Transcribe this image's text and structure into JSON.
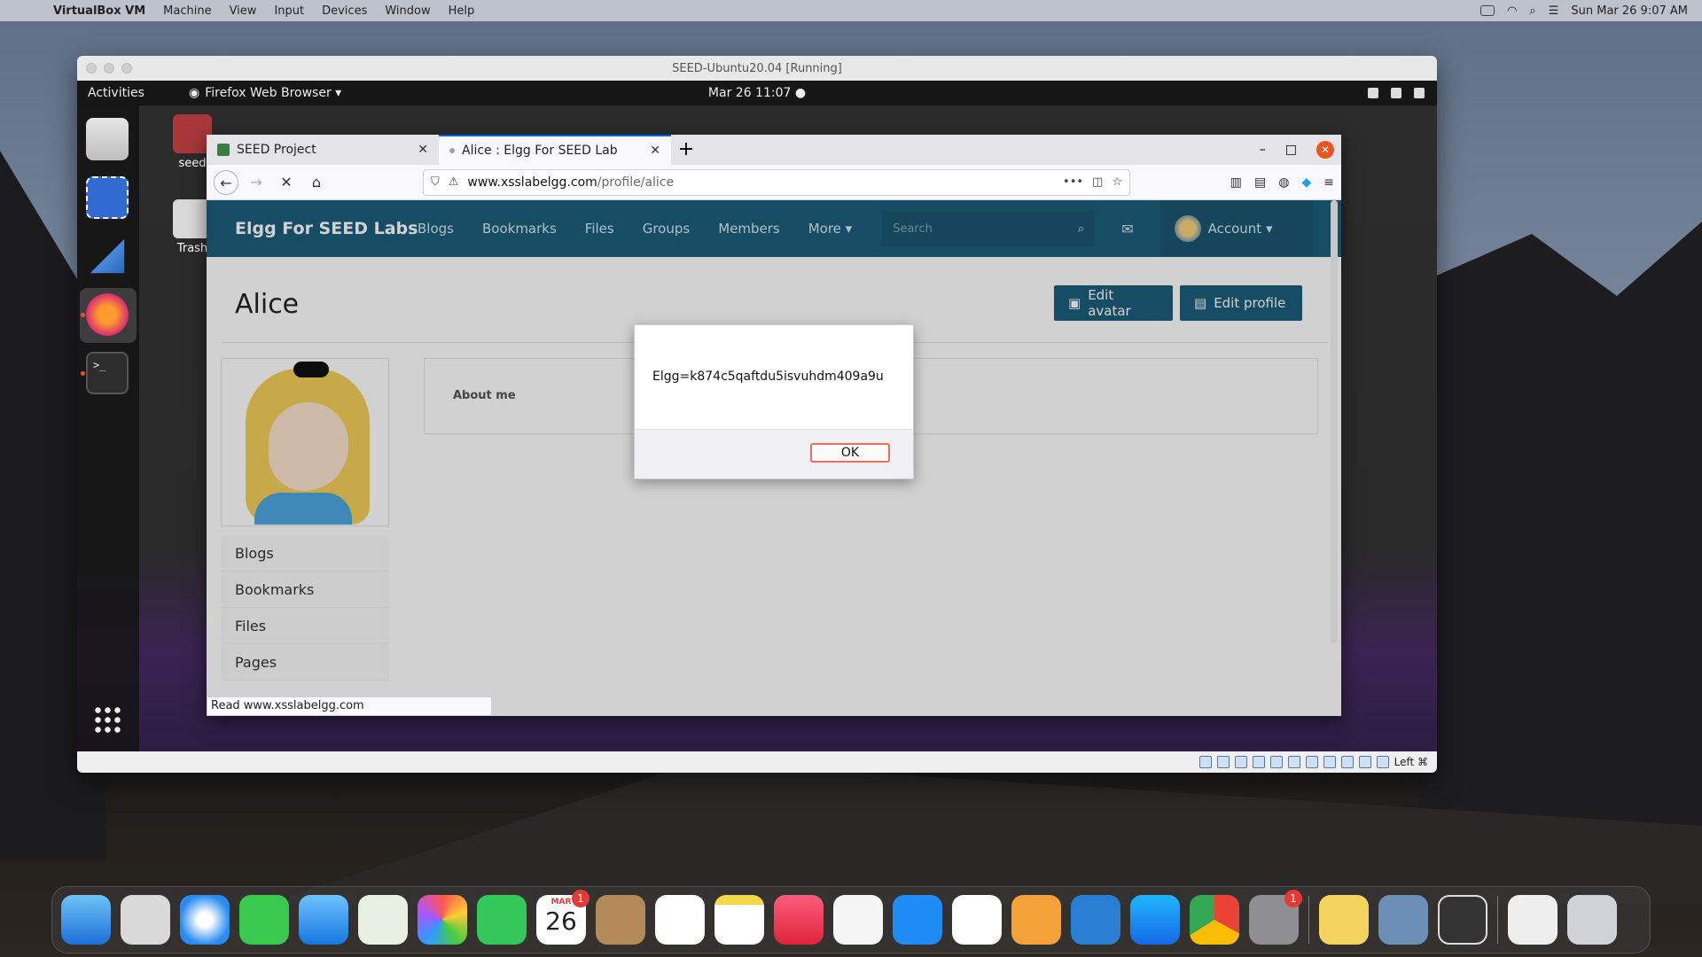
{
  "mac_menubar": {
    "app": "VirtualBox VM",
    "menus": [
      "Machine",
      "View",
      "Input",
      "Devices",
      "Window",
      "Help"
    ],
    "clock": "Sun Mar 26  9:07 AM"
  },
  "vbox": {
    "title": "SEED-Ubuntu20.04 [Running]",
    "status_host_key": "Left ⌘"
  },
  "ubuntu": {
    "activities": "Activities",
    "app_menu": "Firefox Web Browser ▾",
    "clock": "Mar 26  11:07  ●",
    "desktop_icons": [
      {
        "label": "seed"
      },
      {
        "label": "Trash"
      }
    ]
  },
  "firefox": {
    "tabs": [
      {
        "label": "SEED Project",
        "close": "✕"
      },
      {
        "label": "Alice : Elgg For SEED Lab",
        "close": "✕"
      }
    ],
    "new_tab": "+",
    "url_host": "www.xsslabelgg.com",
    "url_path": "/profile/alice",
    "status_tip": "Read www.xsslabelgg.com"
  },
  "elgg": {
    "brand": "Elgg For SEED Labs",
    "nav": [
      "Blogs",
      "Bookmarks",
      "Files",
      "Groups",
      "Members",
      "More ▾"
    ],
    "search_placeholder": "Search",
    "account": "Account ▾",
    "profile_name": "Alice",
    "edit_avatar": "Edit avatar",
    "edit_profile": "Edit profile",
    "about_label": "About me",
    "side_menu": [
      "Blogs",
      "Bookmarks",
      "Files",
      "Pages"
    ]
  },
  "alert": {
    "message": "Elgg=k874c5qaftdu5isvuhdm409a9u",
    "ok": "OK"
  },
  "mac_dock": {
    "calendar_month": "MAR",
    "calendar_day": "26",
    "calendar_badge": "1",
    "settings_badge": "1"
  }
}
